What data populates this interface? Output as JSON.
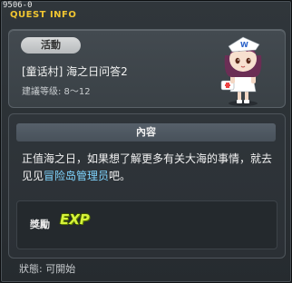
{
  "quest_id": "9506-0",
  "title": "QUEST INFO",
  "header": {
    "type_badge": "活動",
    "quest_name": "[童话村] 海之日问答2",
    "level_label": "建議等级: 8～12"
  },
  "npc": {
    "icon": "npc-nurse-character"
  },
  "content": {
    "section_title": "內容",
    "description_prefix": "正值海之日，如果想了解更多有关大海的事情，就去见见",
    "npc_link": "冒险岛管理员",
    "description_suffix": "吧。"
  },
  "reward": {
    "label": "獎勵",
    "item": "EXP"
  },
  "status": "狀態: 可開始",
  "colors": {
    "title": "#f0c531",
    "npc_link": "#7fd5ff",
    "exp": "#d6f33a"
  }
}
